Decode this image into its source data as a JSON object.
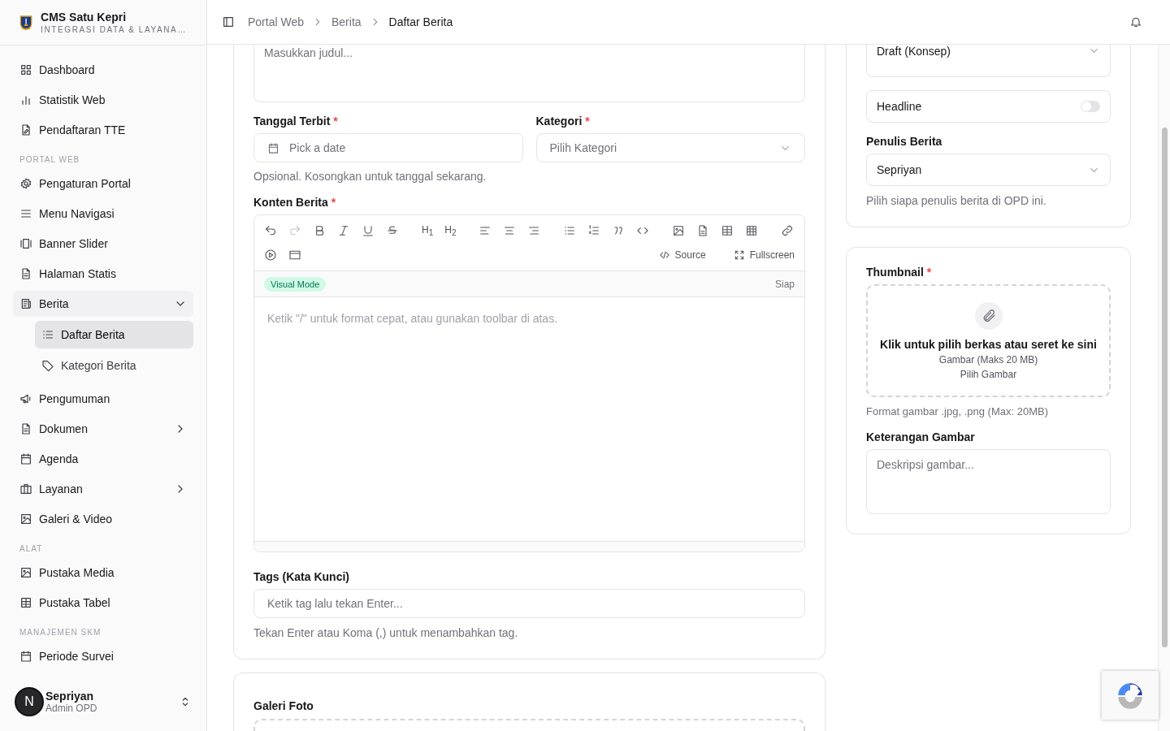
{
  "app": {
    "title": "CMS Satu Kepri",
    "subtitle": "INTEGRASI DATA & LAYANA…"
  },
  "nav": [
    {
      "kind": "item",
      "label": "Dashboard",
      "selected": false
    },
    {
      "kind": "item",
      "label": "Statistik Web",
      "selected": false
    },
    {
      "kind": "item",
      "label": "Pendaftaran TTE",
      "selected": false
    },
    {
      "kind": "section",
      "label": "PORTAL WEB"
    },
    {
      "kind": "item",
      "label": "Pengaturan Portal",
      "selected": false
    },
    {
      "kind": "item",
      "label": "Menu Navigasi",
      "selected": false
    },
    {
      "kind": "item",
      "label": "Banner Slider",
      "selected": false
    },
    {
      "kind": "item",
      "label": "Halaman Statis",
      "selected": false
    },
    {
      "kind": "item",
      "label": "Berita",
      "selected": false,
      "expanded": true,
      "children": [
        {
          "label": "Daftar Berita",
          "selected": true
        },
        {
          "label": "Kategori Berita",
          "selected": false
        }
      ]
    },
    {
      "kind": "item",
      "label": "Pengumuman",
      "selected": false
    },
    {
      "kind": "item",
      "label": "Dokumen",
      "selected": false,
      "expanded": false
    },
    {
      "kind": "item",
      "label": "Agenda",
      "selected": false
    },
    {
      "kind": "item",
      "label": "Layanan",
      "selected": false,
      "expanded": false
    },
    {
      "kind": "item",
      "label": "Galeri & Video",
      "selected": false
    },
    {
      "kind": "section",
      "label": "ALAT"
    },
    {
      "kind": "item",
      "label": "Pustaka Media",
      "selected": false
    },
    {
      "kind": "item",
      "label": "Pustaka Tabel",
      "selected": false
    },
    {
      "kind": "section",
      "label": "MANAJEMEN SKM"
    },
    {
      "kind": "item",
      "label": "Periode Survei",
      "selected": false
    }
  ],
  "user": {
    "initial": "N",
    "name": "Sepriyan",
    "role": "Admin OPD"
  },
  "breadcrumb": [
    "Portal Web",
    "Berita",
    "Daftar Berita"
  ],
  "form": {
    "title_placeholder": "Masukkan judul...",
    "date": {
      "label": "Tanggal Terbit",
      "required_mark": "*",
      "placeholder": "Pick a date",
      "hint": "Opsional. Kosongkan untuk tanggal sekarang."
    },
    "category": {
      "label": "Kategori",
      "required_mark": "*",
      "placeholder": "Pilih Kategori"
    },
    "content": {
      "label": "Konten Berita",
      "required_mark": "*"
    },
    "editor": {
      "redo_disabled": true,
      "headings": [
        "H$_{1}$",
        "H$_{2}$"
      ],
      "source": "Source",
      "fullscreen": "Fullscreen",
      "mode": "Visual Mode",
      "status": "Siap",
      "placeholder": "Ketik \"/\" untuk format cepat, atau gunakan toolbar di atas."
    },
    "tags": {
      "label": "Tags (Kata Kunci)",
      "placeholder": "Ketik tag lalu tekan Enter...",
      "hint": "Tekan Enter atau Koma (,) untuk menambahkan tag."
    },
    "gallery": {
      "label": "Galeri Foto"
    }
  },
  "settings": {
    "status": {
      "value": "Draft (Konsep)"
    },
    "headline": {
      "label": "Headline",
      "on": false
    },
    "writer": {
      "label": "Penulis Berita",
      "value": "Sepriyan",
      "hint": "Pilih siapa penulis berita di OPD ini."
    },
    "thumbnail": {
      "label": "Thumbnail",
      "required_mark": "*",
      "drop_title": "Klik untuk pilih berkas atau seret ke sini",
      "drop_sub": "Gambar (Maks 20 MB)",
      "drop_link": "Pilih Gambar",
      "hint": "Format gambar .jpg, .png (Max: 20MB)"
    },
    "caption": {
      "label": "Keterangan Gambar",
      "placeholder": "Deskripsi gambar..."
    }
  }
}
